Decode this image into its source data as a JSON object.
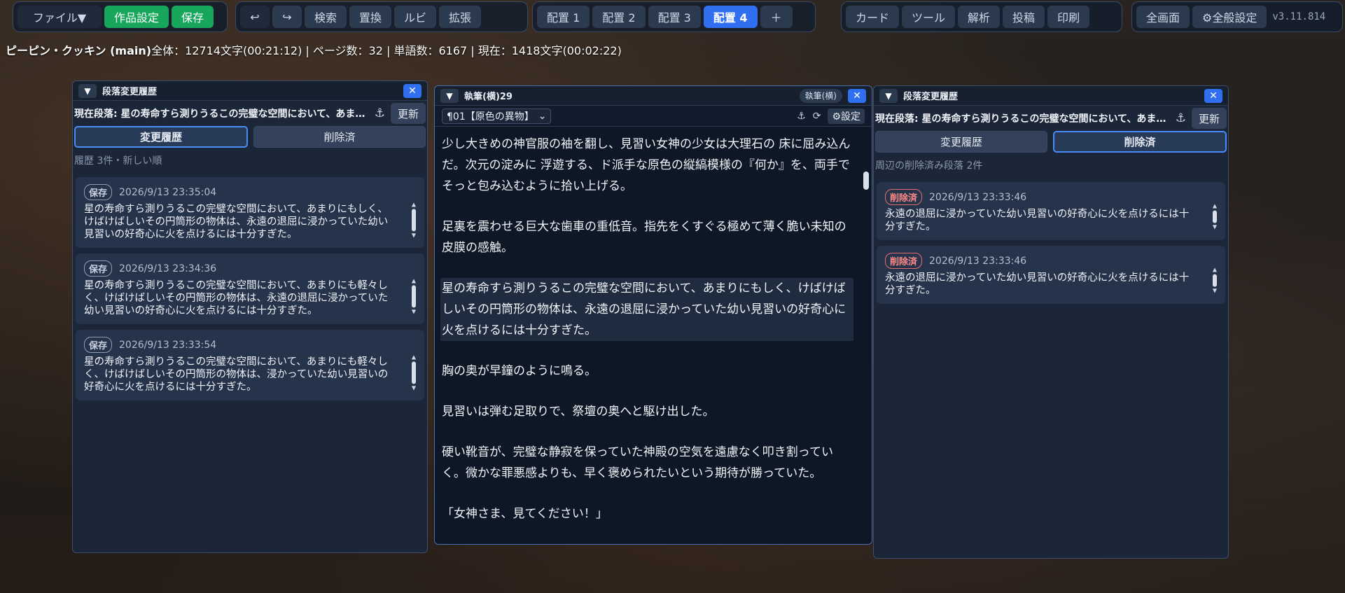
{
  "toolbar": {
    "file": "ファイル▼",
    "work_settings": "作品設定",
    "save": "保存",
    "undo": "↩",
    "redo": "↪",
    "search": "検索",
    "replace": "置換",
    "ruby": "ルビ",
    "extend": "拡張",
    "layouts": [
      "配置 1",
      "配置 2",
      "配置 3",
      "配置 4"
    ],
    "add_layout": "＋",
    "card": "カード",
    "tool": "ツール",
    "analysis": "解析",
    "post": "投稿",
    "print": "印刷",
    "fullscreen": "全画面",
    "global_settings": "⚙全般設定",
    "version": "v3.11.814"
  },
  "status": {
    "title": "ピーピン・クッキン (main)",
    "stats": "全体：12714文字(00:21:12) | ページ数：32 | 単語数：6167 | 現在：1418文字(00:02:22)"
  },
  "left_panel": {
    "title": "段落変更履歴",
    "current": "現在段落: 星の寿命すら測りうるこの完璧な空間において、あまりにもしく、けばけばしいその円筒形の物体は",
    "refresh": "更新",
    "tabs": [
      "変更履歴",
      "削除済"
    ],
    "info": "履歴 3件・新しい順",
    "entries": [
      {
        "badge": "保存",
        "time": "2026/9/13 23:35:04",
        "text": "星の寿命すら測りうるこの完璧な空間において、あまりにもしく、けばけばしいその円筒形の物体は、永遠の退屈に浸かっていた幼い見習いの好奇心に火を点けるには十分すぎた。"
      },
      {
        "badge": "保存",
        "time": "2026/9/13 23:34:36",
        "text": "星の寿命すら測りうるこの完璧な空間において、あまりにも軽々しく、けばけばしいその円筒形の物体は、永遠の退屈に浸かっていた幼い見習いの好奇心に火を点けるには十分すぎた。"
      },
      {
        "badge": "保存",
        "time": "2026/9/13 23:33:54",
        "text": "星の寿命すら測りうるこの完璧な空間において、あまりにも軽々しく、けばけばしいその円筒形の物体は、浸かっていた幼い見習いの好奇心に火を点けるには十分すぎた。"
      }
    ]
  },
  "editor": {
    "title": "執筆(横)29",
    "mode": "執筆(横)",
    "chapter": "¶01【原色の異物】",
    "anchor": "⚓",
    "reload": "⟳",
    "settings": "⚙設定",
    "paragraphs": [
      "少し大きめの神官服の袖を翻し、見習い女神の少女は大理石の 床に屈み込んだ。次元の淀みに 浮遊する、ド派手な原色の縦縞模様の『何か』を、両手でそっと包み込むように拾い上げる。",
      "足裏を震わせる巨大な歯車の重低音。指先をくすぐる極めて薄く脆い未知の皮膜の感触。",
      "星の寿命すら測りうるこの完璧な空間において、あまりにもしく、けばけばしいその円筒形の物体は、永遠の退屈に浸かっていた幼い見習いの好奇心に火を点けるには十分すぎた。",
      "胸の奥が早鐘のように鳴る。",
      "見習いは弾む足取りで、祭壇の奥へと駆け出した。",
      "硬い靴音が、完璧な静寂を保っていた神殿の空気を遠慮なく叩き割っていく。微かな罪悪感よりも、早く褒められたいという期待が勝っていた。",
      "「女神さま、見てください！」"
    ]
  },
  "right_panel": {
    "title": "段落変更履歴",
    "current": "現在段落: 星の寿命すら測りうるこの完璧な空間において、あまりにもしく、けばけばしいその円筒形の物体は",
    "refresh": "更新",
    "tabs": [
      "変更履歴",
      "削除済"
    ],
    "info": "周辺の削除済み段落 2件",
    "entries": [
      {
        "badge": "削除済",
        "time": "2026/9/13 23:33:46",
        "text": "永遠の退屈に浸かっていた幼い見習いの好奇心に火を点けるには十分すぎた。"
      },
      {
        "badge": "削除済",
        "time": "2026/9/13 23:33:46",
        "text": "永遠の退屈に浸かっていた幼い見習いの好奇心に火を点けるには十分すぎた。"
      }
    ]
  },
  "colors": {
    "accent": "#2f6ff0",
    "green": "#17a65b",
    "panel": "#1b2638",
    "deleted_badge": "#e86b6b"
  }
}
